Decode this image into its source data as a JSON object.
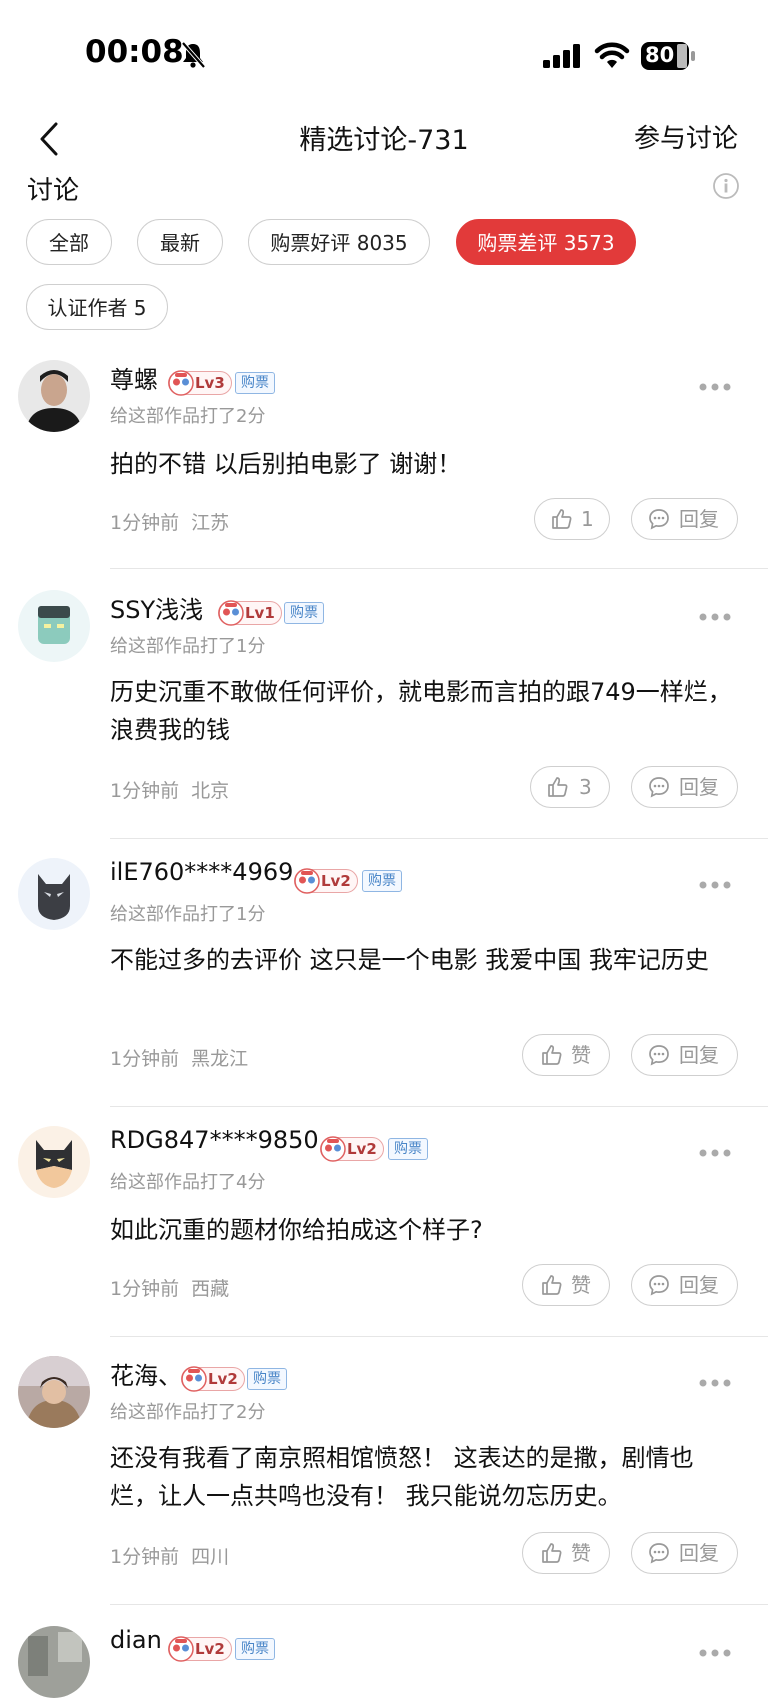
{
  "status": {
    "time": "00:08",
    "battery": "80"
  },
  "nav": {
    "title": "精选讨论-731",
    "join": "参与讨论"
  },
  "section": {
    "title": "讨论"
  },
  "filters": [
    {
      "label": "全部"
    },
    {
      "label": "最新"
    },
    {
      "label": "购票好评 8035"
    },
    {
      "label": "购票差评 3573",
      "active": true
    },
    {
      "label": "认证作者 5"
    }
  ],
  "comments": [
    {
      "name": "尊螺",
      "level": "Lv3",
      "badge": "购票",
      "rating": "给这部作品打了2分",
      "text": "拍的不错 以后别拍电影了 谢谢！",
      "time": "1分钟前",
      "location": "江苏",
      "like": "1",
      "reply": "回复"
    },
    {
      "name": "SSY浅浅",
      "level": "Lv1",
      "badge": "购票",
      "rating": "给这部作品打了1分",
      "text": "历史沉重不敢做任何评价，就电影而言拍的跟749一样烂，浪费我的钱",
      "time": "1分钟前",
      "location": "北京",
      "like": "3",
      "reply": "回复"
    },
    {
      "name": "ilE760****4969",
      "level": "Lv2",
      "badge": "购票",
      "rating": "给这部作品打了1分",
      "text": "不能过多的去评价 这只是一个电影 我爱中国 我牢记历史",
      "time": "1分钟前",
      "location": "黑龙江",
      "like": "赞",
      "reply": "回复"
    },
    {
      "name": "RDG847****9850",
      "level": "Lv2",
      "badge": "购票",
      "rating": "给这部作品打了4分",
      "text": "如此沉重的题材你给拍成这个样子?",
      "time": "1分钟前",
      "location": "西藏",
      "like": "赞",
      "reply": "回复"
    },
    {
      "name": "花海、",
      "level": "Lv2",
      "badge": "购票",
      "rating": "给这部作品打了2分",
      "text": "还没有我看了南京照相馆愤怒！ 这表达的是撒，剧情也烂，让人一点共鸣也没有！ 我只能说勿忘历史。",
      "time": "1分钟前",
      "location": "四川",
      "like": "赞",
      "reply": "回复"
    },
    {
      "name": "dian",
      "level": "Lv2",
      "badge": "购票"
    }
  ],
  "colors": {
    "accent": "#e23a3a",
    "badge_blue": "#4a86c8",
    "muted": "#999999"
  },
  "icons": [
    "bell-muted-icon",
    "signal-icon",
    "wifi-icon",
    "battery-icon",
    "back-icon",
    "info-icon",
    "thumbs-up-icon",
    "chat-bubble-icon",
    "more-icon"
  ]
}
